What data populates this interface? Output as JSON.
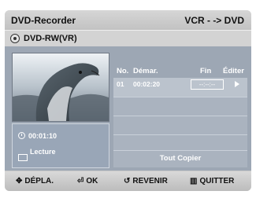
{
  "header": {
    "title": "DVD-Recorder",
    "mode": "VCR - -> DVD"
  },
  "disc": {
    "icon": "disc-icon",
    "label": "DVD-RW(VR)"
  },
  "info": {
    "time": "00:01:10",
    "time_icon": "clock-icon",
    "mode": "Lecture",
    "mode_icon": "playback-icon"
  },
  "columns": {
    "no": "No.",
    "start": "Démar.",
    "end": "Fin",
    "edit": "Éditer"
  },
  "rows": [
    {
      "no": "01",
      "start": "00:02:20",
      "end": "--:--:--"
    }
  ],
  "copy_all": "Tout Copier",
  "nav": {
    "move_label": "DÉPLA.",
    "ok_label": "OK",
    "return_label": "REVENIR",
    "exit_label": "QUITTER"
  }
}
